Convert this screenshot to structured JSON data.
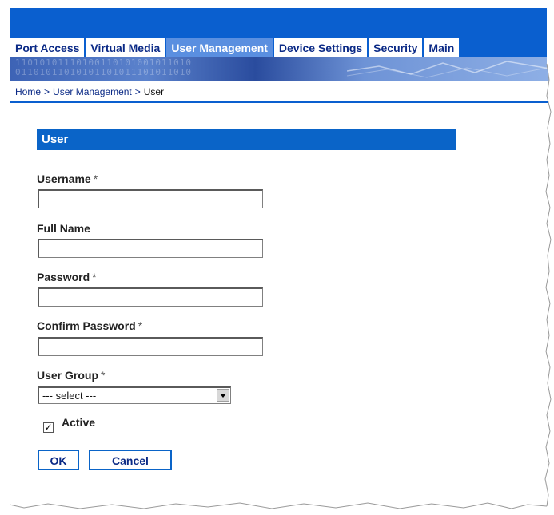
{
  "nav": {
    "tabs": [
      {
        "label": "Port Access"
      },
      {
        "label": "Virtual Media"
      },
      {
        "label": "User Management",
        "active": true
      },
      {
        "label": "Device Settings"
      },
      {
        "label": "Security"
      },
      {
        "label": "Main"
      }
    ]
  },
  "breadcrumb": {
    "home": "Home",
    "separator": ">",
    "section": "User Management",
    "current": "User"
  },
  "form": {
    "title": "User",
    "username_label": "Username",
    "full_name_label": "Full Name",
    "password_label": "Password",
    "confirm_password_label": "Confirm Password",
    "user_group_label": "User Group",
    "required_marker": "*",
    "user_group_value": "--- select ---",
    "active_label": "Active",
    "active_checked": true,
    "ok_label": "OK",
    "cancel_label": "Cancel"
  },
  "colors": {
    "brand_blue": "#0a5fcf",
    "active_tab": "#5a8fe0",
    "section_header": "#0a64c8"
  }
}
